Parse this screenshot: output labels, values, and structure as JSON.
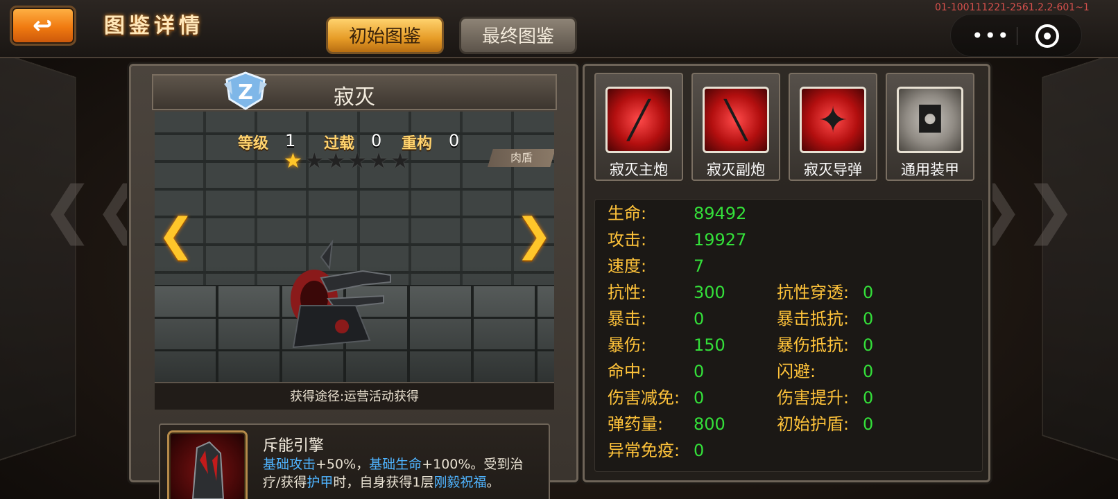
{
  "header": {
    "back_icon": "return-arrow-icon",
    "title": "图鉴详情",
    "version": "01-100111221-2561.2.2-601~1",
    "tabs": [
      {
        "label": "初始图鉴",
        "active": true
      },
      {
        "label": "最终图鉴",
        "active": false
      }
    ],
    "capsule": {
      "more_label": "•••",
      "close_icon": "target-close-icon"
    }
  },
  "unit": {
    "name": "寂灭",
    "rank_badge": "Z",
    "level_label": "等级",
    "level_value": "1",
    "overload_label": "过载",
    "overload_value": "0",
    "rebuild_label": "重构",
    "rebuild_value": "0",
    "stars_total": 6,
    "stars_filled": 1,
    "role_tag": "肉盾",
    "source": "获得途径:运营活动获得"
  },
  "skill": {
    "name": "斥能引擎",
    "desc_parts": [
      {
        "text": "基础攻击",
        "hl": true
      },
      {
        "text": "+50%，",
        "hl": false
      },
      {
        "text": "基础生命",
        "hl": true
      },
      {
        "text": "+100%。受到治疗/获得",
        "hl": false
      },
      {
        "text": "护甲",
        "hl": true
      },
      {
        "text": "时，自身获得1层",
        "hl": false
      },
      {
        "text": "刚毅祝福",
        "hl": true
      },
      {
        "text": "。",
        "hl": false
      }
    ]
  },
  "equipment": [
    {
      "label": "寂灭主炮",
      "icon": "main-cannon-icon",
      "style": "red"
    },
    {
      "label": "寂灭副炮",
      "icon": "sub-cannon-icon",
      "style": "red"
    },
    {
      "label": "寂灭导弹",
      "icon": "missile-icon",
      "style": "red"
    },
    {
      "label": "通用装甲",
      "icon": "armor-icon",
      "style": "grey"
    }
  ],
  "attributes_left": [
    {
      "label": "生命:",
      "value": "89492"
    },
    {
      "label": "攻击:",
      "value": "19927"
    },
    {
      "label": "速度:",
      "value": "7"
    },
    {
      "label": "抗性:",
      "value": "300"
    },
    {
      "label": "暴击:",
      "value": "0"
    },
    {
      "label": "暴伤:",
      "value": "150"
    },
    {
      "label": "命中:",
      "value": "0"
    },
    {
      "label": "伤害减免:",
      "value": "0"
    },
    {
      "label": "弹药量:",
      "value": "800"
    },
    {
      "label": "异常免疫:",
      "value": "0"
    }
  ],
  "attributes_right": [
    {
      "label": "抗性穿透:",
      "value": "0"
    },
    {
      "label": "暴击抵抗:",
      "value": "0"
    },
    {
      "label": "暴伤抵抗:",
      "value": "0"
    },
    {
      "label": "闪避:",
      "value": "0"
    },
    {
      "label": "伤害提升:",
      "value": "0"
    },
    {
      "label": "初始护盾:",
      "value": "0"
    }
  ],
  "colors": {
    "accent_orange": "#f07a10",
    "attr_label": "#ffc33a",
    "attr_value": "#34e03a",
    "highlight_blue": "#4fb4ff",
    "version_red": "#d8514d"
  }
}
